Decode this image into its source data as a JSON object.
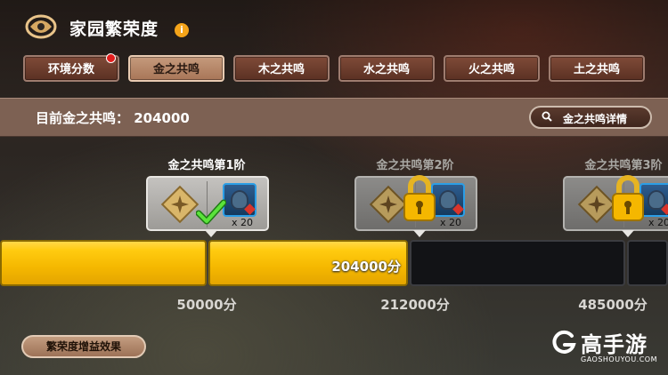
{
  "header": {
    "title": "家园繁荣度",
    "info_icon": "i"
  },
  "tabs": [
    {
      "label": "环境分数",
      "active": false,
      "badge": true
    },
    {
      "label": "金之共鸣",
      "active": true,
      "badge": false
    },
    {
      "label": "木之共鸣",
      "active": false,
      "badge": false
    },
    {
      "label": "水之共鸣",
      "active": false,
      "badge": false
    },
    {
      "label": "火之共鸣",
      "active": false,
      "badge": false
    },
    {
      "label": "土之共鸣",
      "active": false,
      "badge": false
    }
  ],
  "summary": {
    "current_label": "目前金之共鸣：  204000",
    "detail_button": "金之共鸣详情"
  },
  "tiers": [
    {
      "title": "金之共鸣第1阶",
      "unlocked": true,
      "reward_qty": "x 20",
      "threshold": "50000分"
    },
    {
      "title": "金之共鸣第2阶",
      "unlocked": false,
      "reward_qty": "x 20",
      "threshold": "212000分"
    },
    {
      "title": "金之共鸣第3阶",
      "unlocked": false,
      "reward_qty": "x 20",
      "threshold": "485000分"
    }
  ],
  "progress": {
    "current": 204000,
    "value_label": "204000分"
  },
  "footer": {
    "boost_button": "繁荣度增益效果"
  },
  "watermark": {
    "name": "高手游",
    "url": "GAOSHOUYOU.COM"
  },
  "colors": {
    "progress_fill": "#ffcb10",
    "active_tab": "#c59a7c",
    "inactive_tab": "#6b3a2a",
    "alert_dot": "#e31d1d"
  }
}
